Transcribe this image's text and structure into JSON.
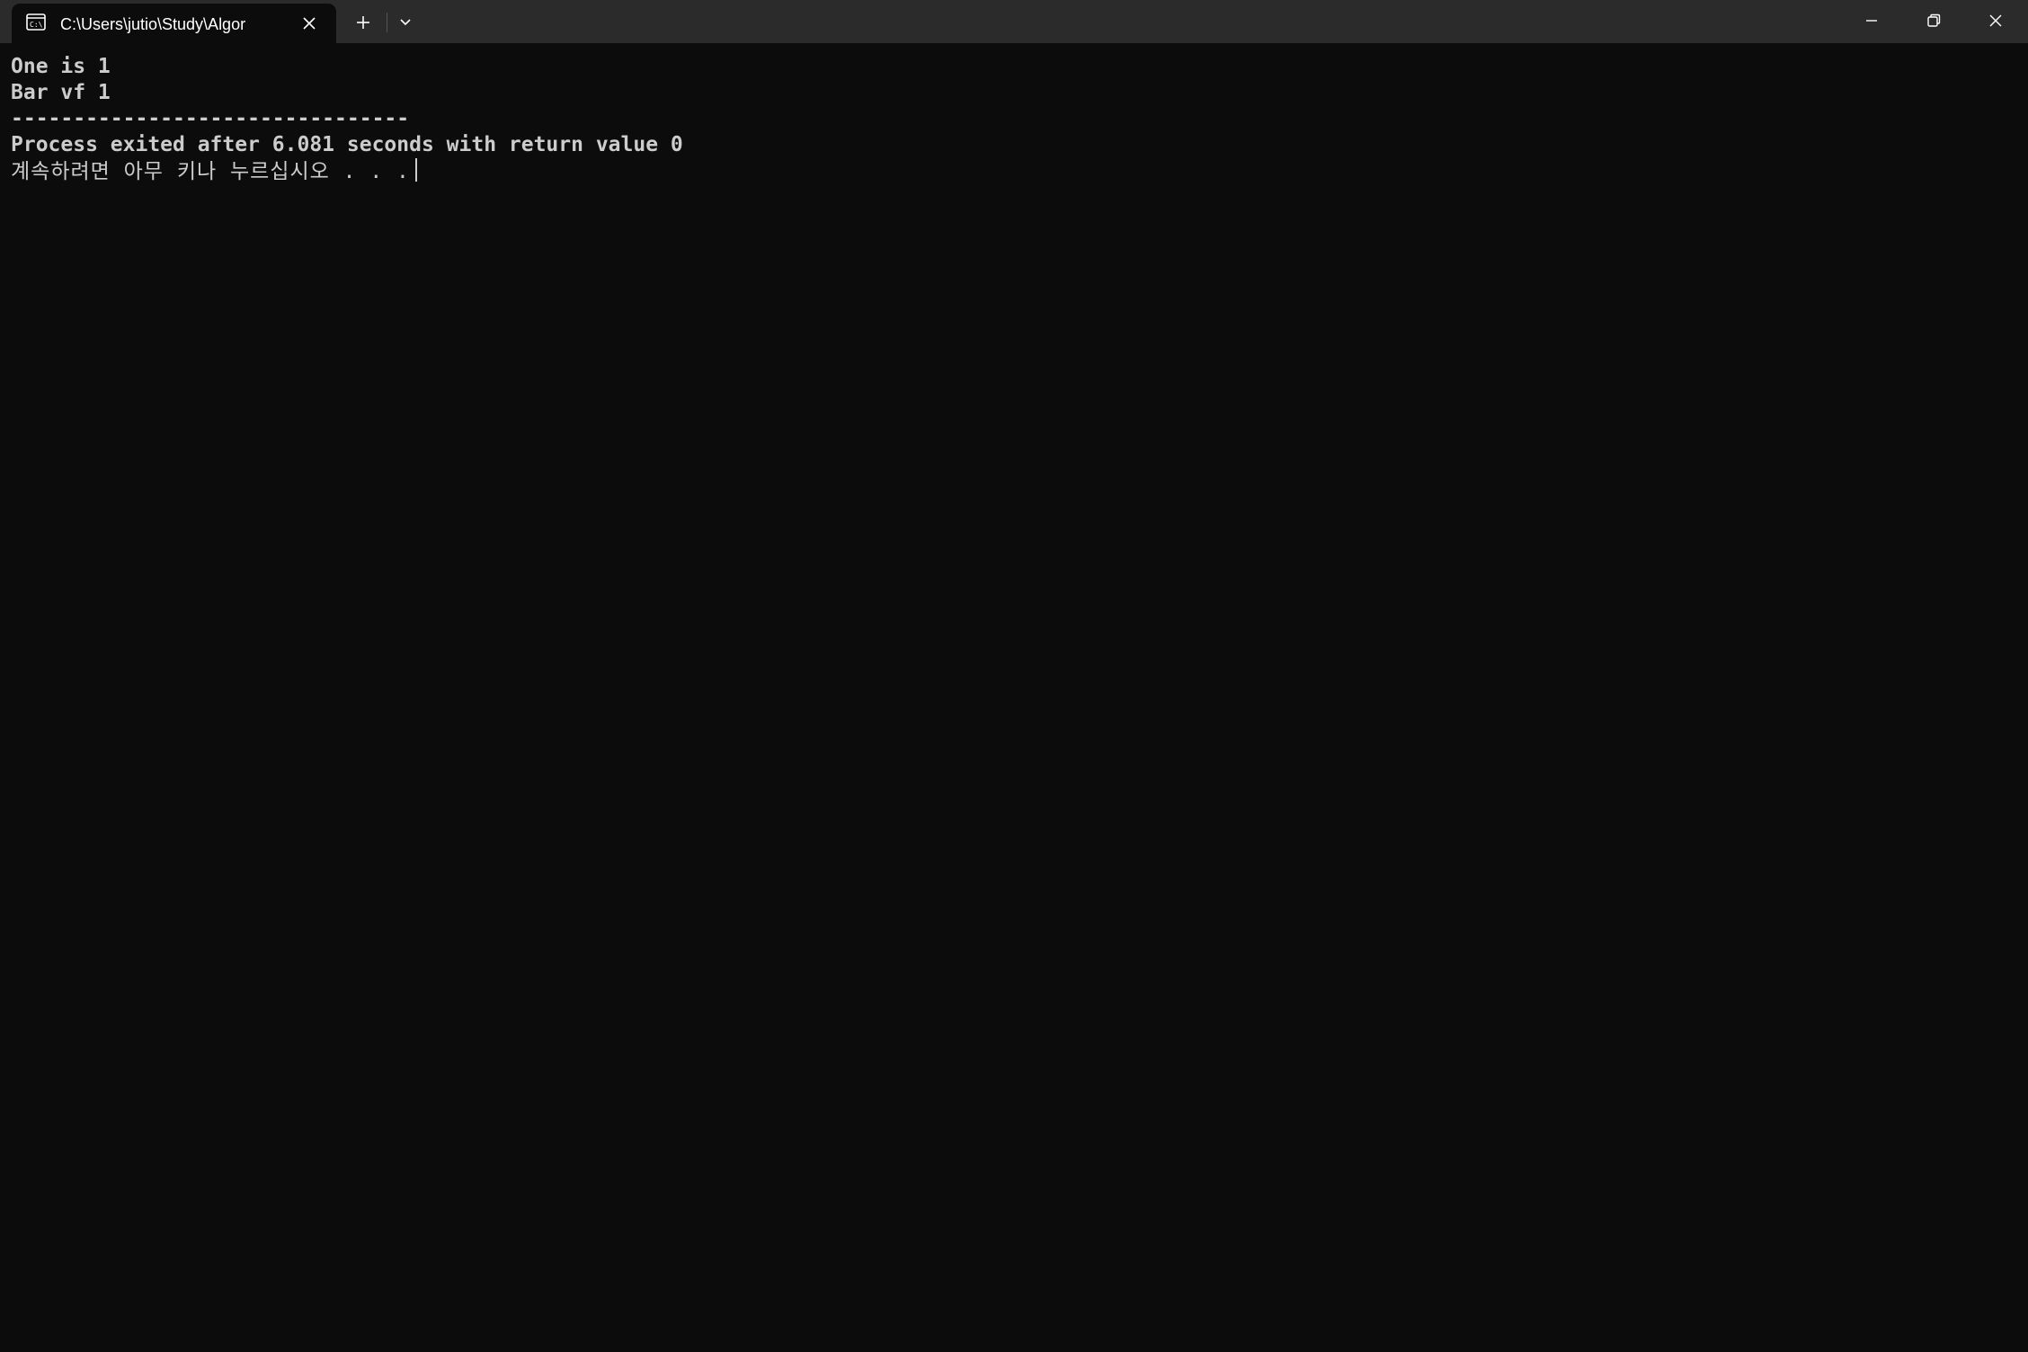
{
  "window": {
    "tab_title": "C:\\Users\\jutio\\Study\\Algor",
    "tab_icon": "console-icon",
    "new_tab_icon": "plus-icon",
    "dropdown_icon": "chevron-down-icon",
    "minimize_icon": "minimize-icon",
    "maximize_icon": "restore-icon",
    "close_icon": "close-icon"
  },
  "terminal": {
    "lines": [
      "One is 1",
      "Bar vf 1",
      "--------------------------------",
      "Process exited after 6.081 seconds with return value 0",
      "계속하려면 아무 키나 누르십시오 . . ."
    ]
  },
  "colors": {
    "titlebar_bg": "#2b2b2b",
    "terminal_bg": "#0c0c0c",
    "text": "#cccccc"
  }
}
